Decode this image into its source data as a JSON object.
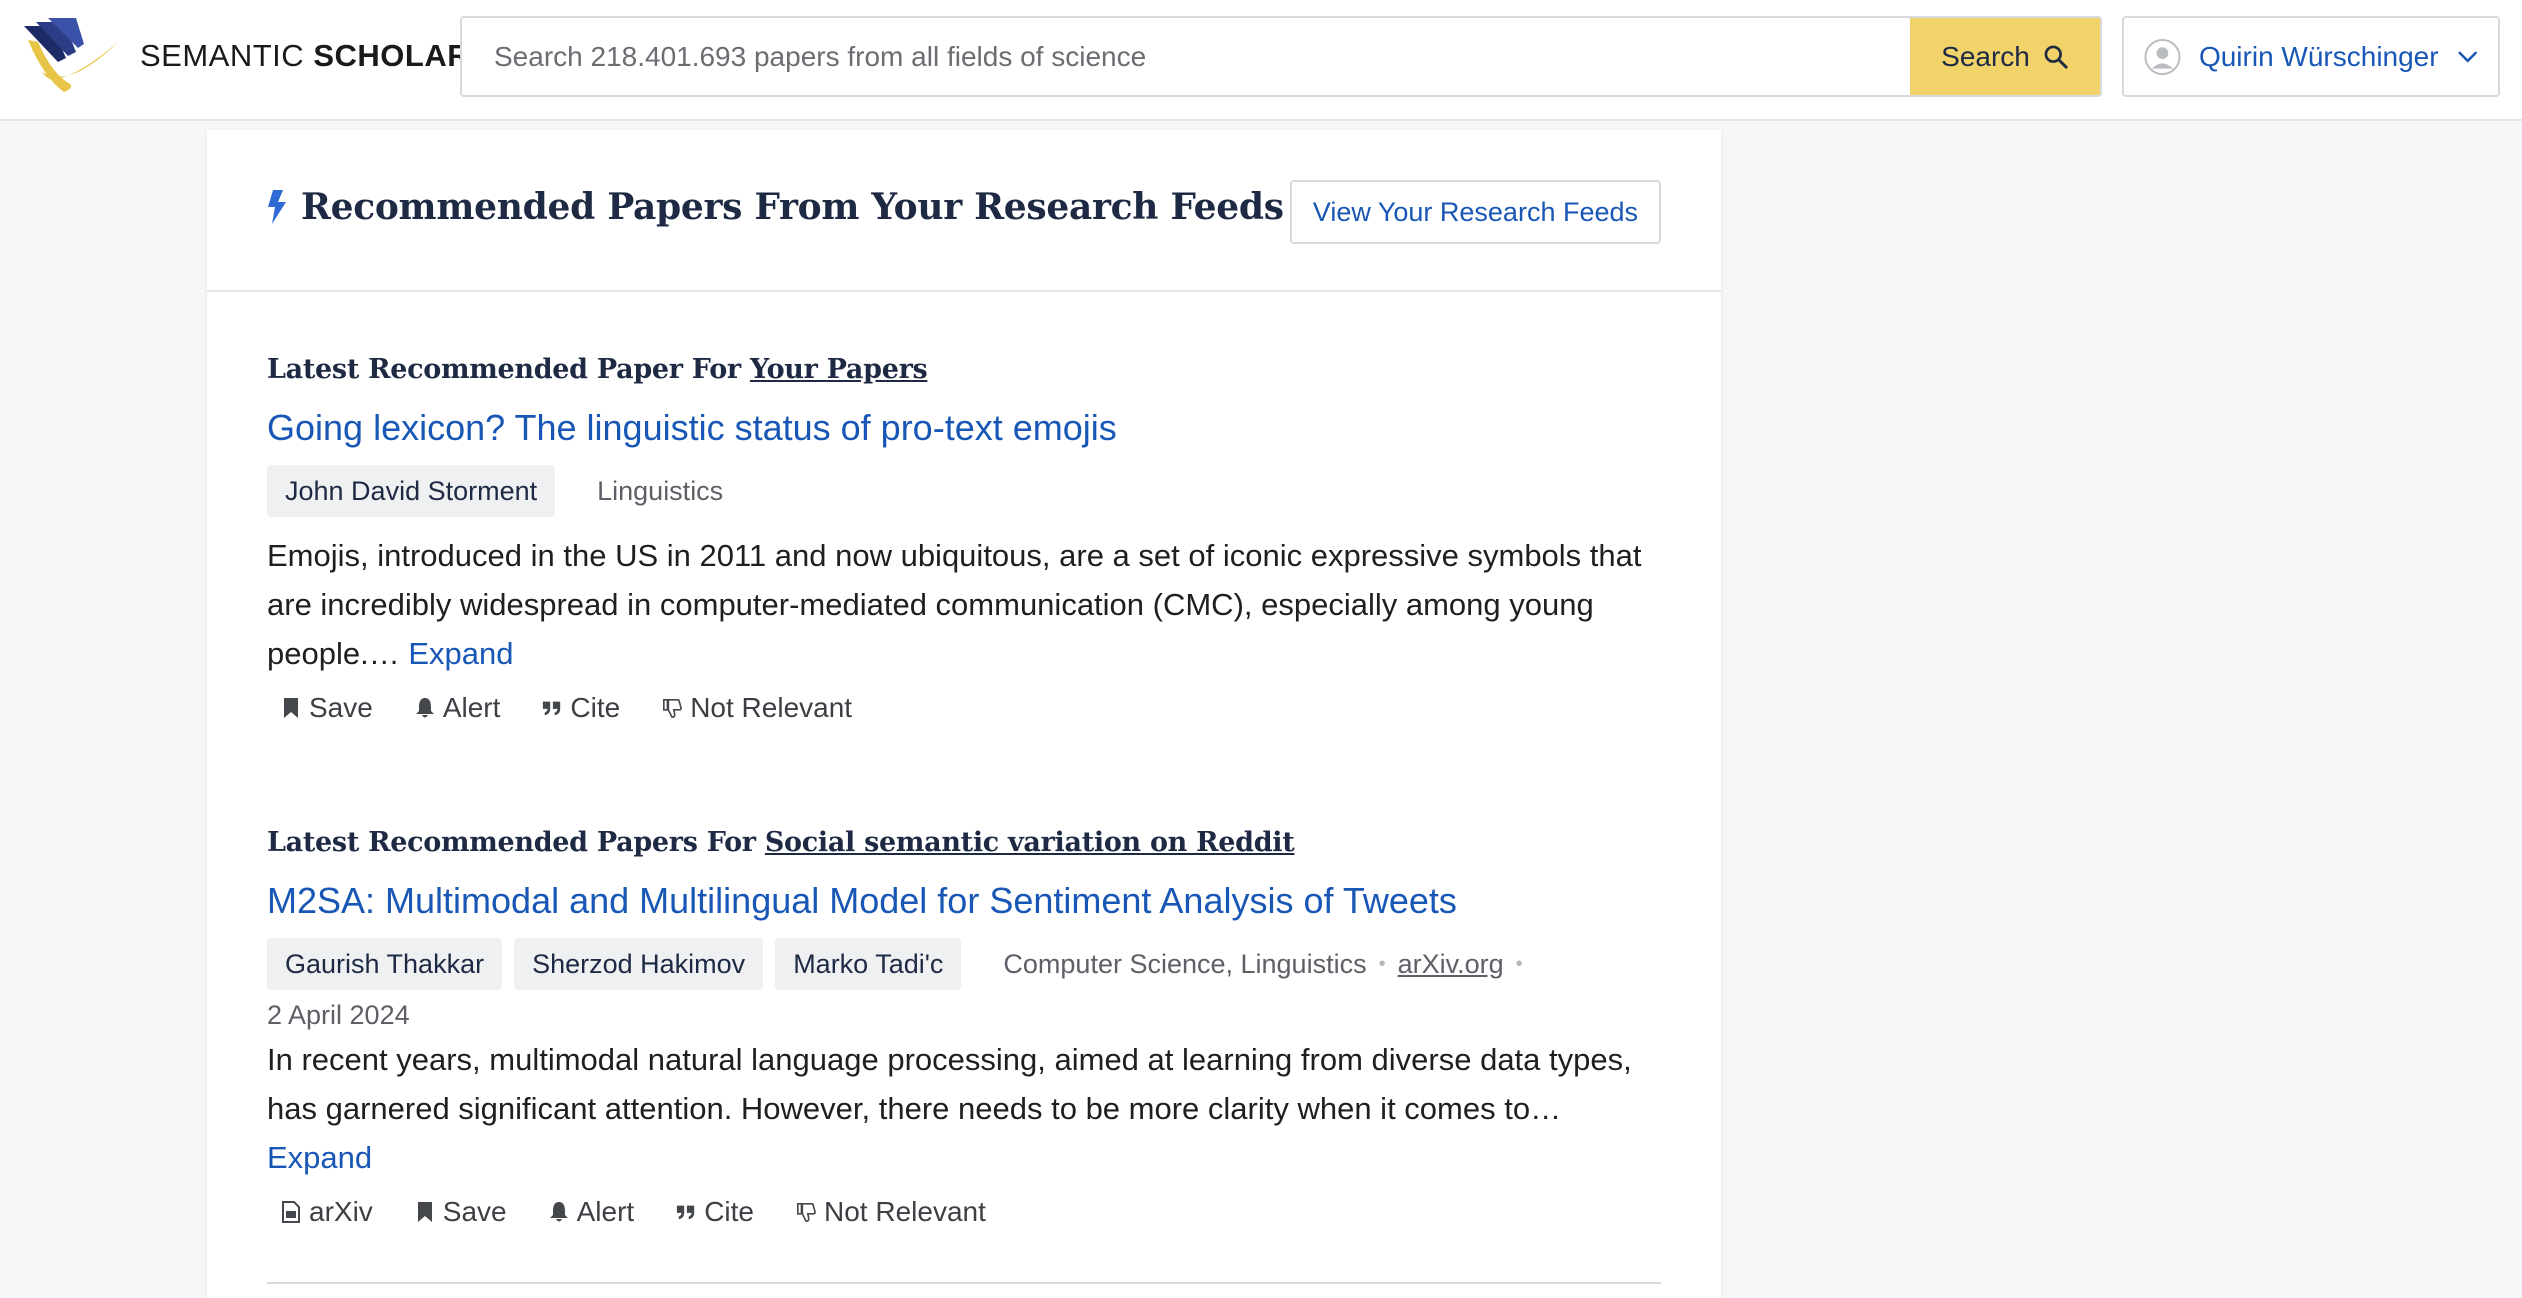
{
  "header": {
    "logo_text_light": "SEMANTIC",
    "logo_text_bold": "SCHOLAR",
    "search_placeholder": "Search 218.401.693 papers from all fields of science",
    "search_button_label": "Search",
    "account_name": "Quirin Würschinger"
  },
  "feed": {
    "title": "Recommended Papers From Your Research Feeds",
    "view_button_label": "View Your Research Feeds"
  },
  "sections": [
    {
      "label_prefix": "Latest Recommended Paper For",
      "label_link": "Your Papers",
      "paper": {
        "title": "Going lexicon? The linguistic status of pro-text emojis",
        "authors": [
          "John David Storment"
        ],
        "fields": "Linguistics",
        "abstract": "Emojis, introduced in the US in 2011 and now ubiquitous, are a set of iconic expressive symbols that are incredibly widespread in computer-mediated communication (CMC), especially among young people.…",
        "expand_label": "Expand"
      },
      "actions": [
        "Save",
        "Alert",
        "Cite",
        "Not Relevant"
      ]
    },
    {
      "label_prefix": "Latest Recommended Papers For",
      "label_link": "Social semantic variation on Reddit",
      "paper": {
        "title": "M2SA: Multimodal and Multilingual Model for Sentiment Analysis of Tweets",
        "authors": [
          "Gaurish Thakkar",
          "Sherzod Hakimov",
          "Marko Tadi'c"
        ],
        "fields": "Computer Science, Linguistics",
        "venue": "arXiv.org",
        "date": "2 April 2024",
        "abstract": "In recent years, multimodal natural language processing, aimed at learning from diverse data types, has garnered significant attention. However, there needs to be more clarity when it comes to…",
        "expand_label": "Expand"
      },
      "actions": [
        "arXiv",
        "Save",
        "Alert",
        "Cite",
        "Not Relevant"
      ]
    }
  ],
  "icons": {
    "logo": "semantic-scholar-logo",
    "search": "search-icon",
    "user": "user-avatar-icon",
    "dropdown": "chevron-down-icon",
    "feed": "lightning-bolt-icon",
    "save": "bookmark-icon",
    "alert": "bell-icon",
    "cite": "quote-icon",
    "not_relevant": "thumbs-down-icon",
    "pdf": "pdf-file-icon"
  },
  "colors": {
    "link_blue": "#1857b6",
    "search_button": "#f1d36a",
    "heading_navy": "#1e2a44",
    "page_background": "#f5f6f7"
  }
}
